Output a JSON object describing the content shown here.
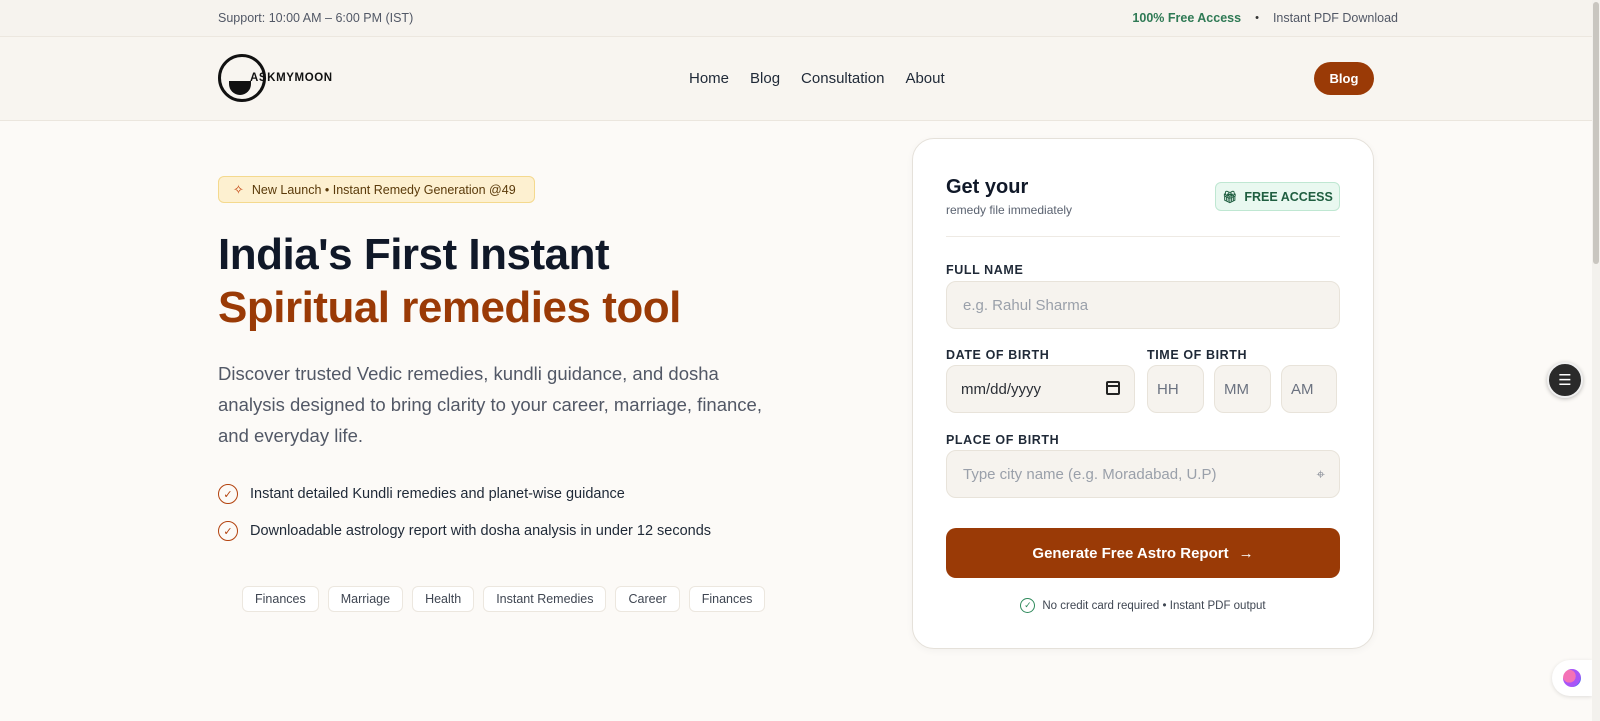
{
  "topbar": {
    "support": "Support: 10:00 AM – 6:00 PM (IST)",
    "free_access": "100% Free Access",
    "separator": "•",
    "pdf": "Instant PDF Download"
  },
  "header": {
    "logo_text": "ASKMYMOON",
    "nav": [
      "Home",
      "Blog",
      "Consultation",
      "About"
    ],
    "cta": "Blog"
  },
  "hero": {
    "badge": "New Launch • Instant Remedy Generation @49",
    "title_line1": "India's First Instant",
    "title_line2": "Spiritual remedies tool",
    "description": "Discover trusted Vedic remedies, kundli guidance, and dosha analysis designed to bring clarity to your career, marriage, finance, and everyday life.",
    "bullets": [
      "Instant detailed Kundli remedies and planet-wise guidance",
      "Downloadable astrology report with dosha analysis in under 12 seconds"
    ],
    "tags": [
      "Finances",
      "Marriage",
      "Health",
      "Instant Remedies",
      "Career",
      "Finances"
    ]
  },
  "form": {
    "title": "Get your",
    "subtitle": "remedy file immediately",
    "free_badge": "FREE ACCESS",
    "full_name_label": "FULL NAME",
    "full_name_placeholder": "e.g. Rahul Sharma",
    "dob_label": "DATE OF BIRTH",
    "dob_value": "mm/dd/yyyy",
    "tob_label": "TIME OF BIRTH",
    "hh": "HH",
    "mm": "MM",
    "ampm": "AM",
    "pob_label": "PLACE OF BIRTH",
    "pob_placeholder": "Type city name (e.g. Moradabad, U.P)",
    "submit": "Generate Free Astro Report",
    "note": "No credit card required • Instant PDF output"
  },
  "colors": {
    "accent": "#9a3a06",
    "success": "#2f7a55",
    "background": "#fcfaf7"
  }
}
